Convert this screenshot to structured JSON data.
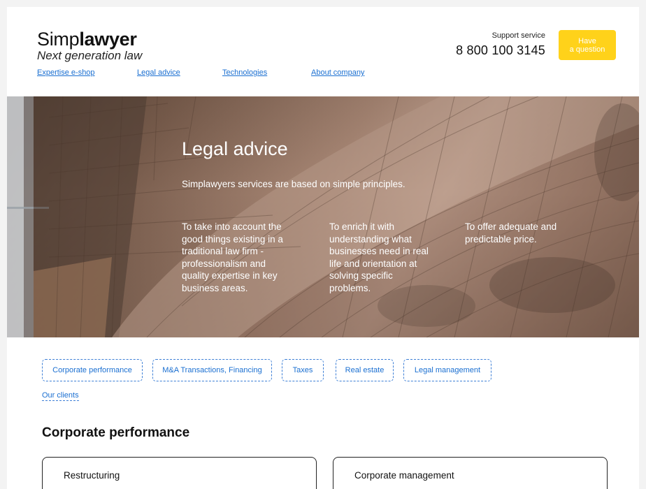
{
  "header": {
    "logo_prefix": "Simp",
    "logo_bold": "lawyer",
    "tagline": "Next generation law",
    "support_label": "Support service",
    "phone": "8 800 100 3145",
    "ask_line1": "Have",
    "ask_line2": "a question"
  },
  "nav": {
    "items": [
      {
        "label": "Expertise e-shop"
      },
      {
        "label": "Legal advice"
      },
      {
        "label": "Technologies"
      },
      {
        "label": "About company"
      }
    ]
  },
  "hero": {
    "title": "Legal advice",
    "subtitle": "Simplawyers services are based on simple principles.",
    "principles": [
      {
        "text": "To take into account the good things existing in a traditional law firm - professionalism and quality expertise in key business areas."
      },
      {
        "text": "To enrich it with understanding what businesses need in real life and orientation at solving specific problems."
      },
      {
        "text": "To offer adequate and predictable price."
      }
    ]
  },
  "tabs": {
    "items": [
      {
        "label": "Corporate performance"
      },
      {
        "label": "M&A Transactions, Financing"
      },
      {
        "label": "Taxes"
      },
      {
        "label": "Real estate"
      },
      {
        "label": "Legal management"
      }
    ]
  },
  "clients_link": "Our clients",
  "section": {
    "title": "Corporate performance",
    "cards": [
      {
        "title": "Restructuring"
      },
      {
        "title": "Corporate management"
      }
    ]
  },
  "colors": {
    "accent_yellow": "#ffd21a",
    "link_blue": "#1a6fd1"
  }
}
